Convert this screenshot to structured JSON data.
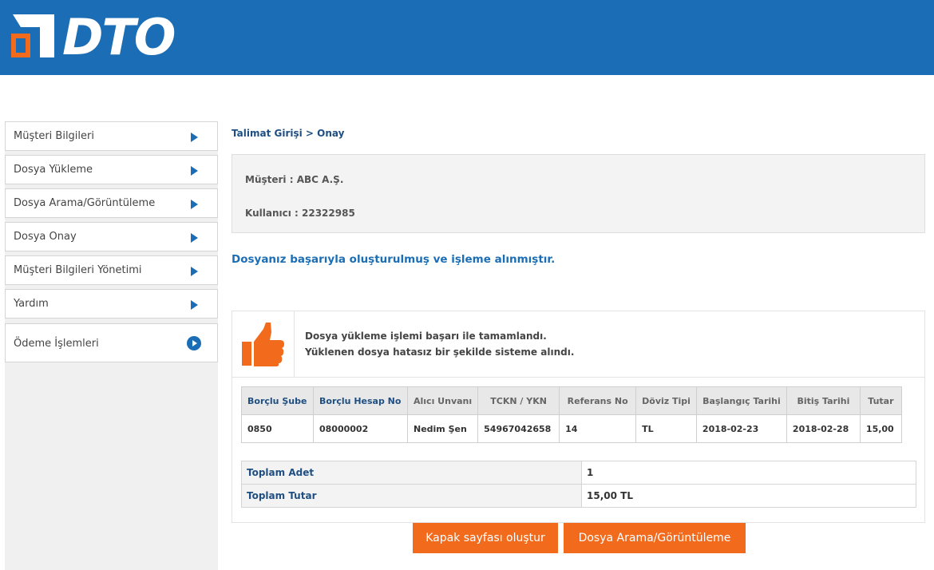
{
  "header": {
    "logo_text": "DTO",
    "brand_color": "#1b6eb5",
    "logo_accent": "#f26a1b"
  },
  "sidebar": {
    "items": [
      {
        "label": "Müşteri Bilgileri",
        "icon": "chevron-right-icon"
      },
      {
        "label": "Dosya Yükleme",
        "icon": "chevron-right-icon"
      },
      {
        "label": "Dosya Arama/Görüntüleme",
        "icon": "chevron-right-icon"
      },
      {
        "label": "Dosya Onay",
        "icon": "chevron-right-icon"
      },
      {
        "label": "Müşteri Bilgileri Yönetimi",
        "icon": "chevron-right-icon"
      },
      {
        "label": "Yardım",
        "icon": "chevron-right-icon"
      },
      {
        "label": "Ödeme İşlemleri",
        "icon": "circle-chevron-icon"
      }
    ]
  },
  "breadcrumb": "Talimat Girişi > Onay",
  "info": {
    "customer": "Müşteri :  ABC A.Ş.",
    "user": "Kullanıcı : 22322985"
  },
  "success_message": "Dosyanız başarıyla oluşturulmuş ve işleme alınmıştır.",
  "result": {
    "icon": "thumbs-up-icon",
    "line1": "Dosya yükleme işlemi başarı ile tamamlandı.",
    "line2": "Yüklenen dosya hatasız bir şekilde sisteme alındı."
  },
  "table": {
    "headers": [
      "Borçlu Şube",
      "Borçlu Hesap No",
      "Alıcı Unvanı",
      "TCKN / YKN",
      "Referans No",
      "Döviz Tipi",
      "Başlangıç Tarihi",
      "Bitiş Tarihi",
      "Tutar"
    ],
    "rows": [
      [
        "0850",
        "08000002",
        "Nedim Şen",
        "54967042658",
        "14",
        "TL",
        "2018-02-23",
        "2018-02-28",
        "15,00"
      ]
    ]
  },
  "totals": [
    {
      "label": "Toplam Adet",
      "value": "1"
    },
    {
      "label": "Toplam Tutar",
      "value": "15,00 TL"
    }
  ],
  "buttons": {
    "cover_page": "Kapak sayfası oluştur",
    "file_search": "Dosya Arama/Görüntüleme"
  }
}
